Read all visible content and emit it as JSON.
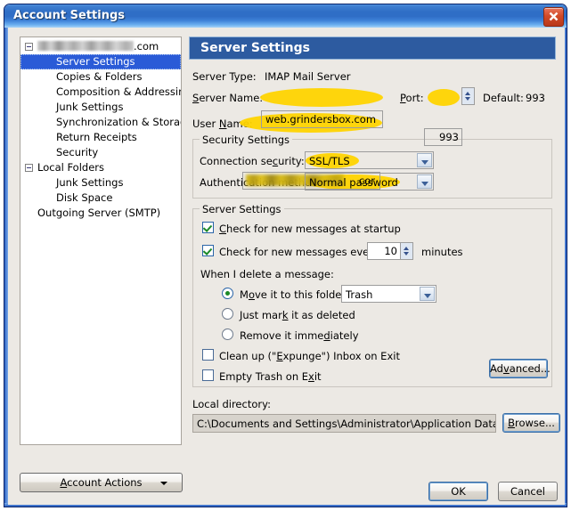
{
  "window": {
    "title": "Account Settings",
    "close_icon": "close-icon",
    "titlebar_color": "#2f6ec6",
    "close_color": "#d14a28"
  },
  "sidebar": {
    "items": [
      {
        "label": ".com",
        "level": 0,
        "twisty": true,
        "redacted": true,
        "selected": false
      },
      {
        "label": "Server Settings",
        "level": 1,
        "twisty": false,
        "redacted": false,
        "selected": true
      },
      {
        "label": "Copies & Folders",
        "level": 1,
        "twisty": false,
        "redacted": false,
        "selected": false
      },
      {
        "label": "Composition & Addressing",
        "level": 1,
        "twisty": false,
        "redacted": false,
        "selected": false
      },
      {
        "label": "Junk Settings",
        "level": 1,
        "twisty": false,
        "redacted": false,
        "selected": false
      },
      {
        "label": "Synchronization & Storage",
        "level": 1,
        "twisty": false,
        "redacted": false,
        "selected": false
      },
      {
        "label": "Return Receipts",
        "level": 1,
        "twisty": false,
        "redacted": false,
        "selected": false
      },
      {
        "label": "Security",
        "level": 1,
        "twisty": false,
        "redacted": false,
        "selected": false
      },
      {
        "label": "Local Folders",
        "level": 0,
        "twisty": true,
        "redacted": false,
        "selected": false
      },
      {
        "label": "Junk Settings",
        "level": 1,
        "twisty": false,
        "redacted": false,
        "selected": false
      },
      {
        "label": "Disk Space",
        "level": 1,
        "twisty": false,
        "redacted": false,
        "selected": false
      },
      {
        "label": "Outgoing Server (SMTP)",
        "level": 0,
        "twisty": false,
        "redacted": false,
        "selected": false
      }
    ],
    "account_actions": {
      "label": "Account Actions",
      "accesskey": "A",
      "arrow_icon": "chevron-down-icon"
    }
  },
  "pane": {
    "header": "Server Settings",
    "server_type": {
      "label": "Server Type:",
      "value": "IMAP Mail Server"
    },
    "server_name": {
      "label": "Server Name:",
      "accesskey": "S",
      "value": "web.grindersbox.com",
      "highlighted": true
    },
    "port": {
      "label": "Port:",
      "accesskey": "P",
      "value": "993",
      "highlighted": true
    },
    "default_port": {
      "label": "Default:",
      "value": "993"
    },
    "user_name": {
      "label": "User Name:",
      "accesskey": "N",
      "value": "cor",
      "redacted": true,
      "highlighted": true
    },
    "security_settings": {
      "title": "Security Settings",
      "connection_security": {
        "label": "Connection security:",
        "accesskey": "c",
        "value": "SSL/TLS",
        "highlighted": true
      },
      "authentication_method": {
        "label": "Authentication method:",
        "accesskey": "i",
        "value": "Normal password",
        "highlighted": true
      }
    },
    "server_settings_group": {
      "title": "Server Settings",
      "check_startup": {
        "label": "Check for new messages at startup",
        "accesskey": "C",
        "checked": true
      },
      "check_every": {
        "label": "Check for new messages every",
        "accesskey": "y",
        "checked": true,
        "value": "10",
        "units": "minutes"
      },
      "delete_prompt": "When I delete a message:",
      "delete_options": [
        {
          "label": "Move it to this folder:",
          "accesskey": "o",
          "selected": true
        },
        {
          "label": "Just mark it as deleted",
          "accesskey": "k",
          "selected": false
        },
        {
          "label": "Remove it immediately",
          "accesskey": "d",
          "selected": false
        }
      ],
      "trash_folder": "Trash",
      "expunge": {
        "label": "Clean up (\"Expunge\") Inbox on Exit",
        "accesskey": "E",
        "checked": false
      },
      "empty_trash": {
        "label": "Empty Trash on Exit",
        "accesskey": "x",
        "checked": false
      },
      "advanced_button": {
        "label": "Advanced...",
        "accesskey": "v"
      }
    },
    "local_directory": {
      "label": "Local directory:",
      "value": "C:\\Documents and Settings\\Administrator\\Application Data\\Thunderb",
      "browse_button": {
        "label": "Browse...",
        "accesskey": "B"
      }
    }
  },
  "footer": {
    "ok": "OK",
    "cancel": "Cancel"
  }
}
